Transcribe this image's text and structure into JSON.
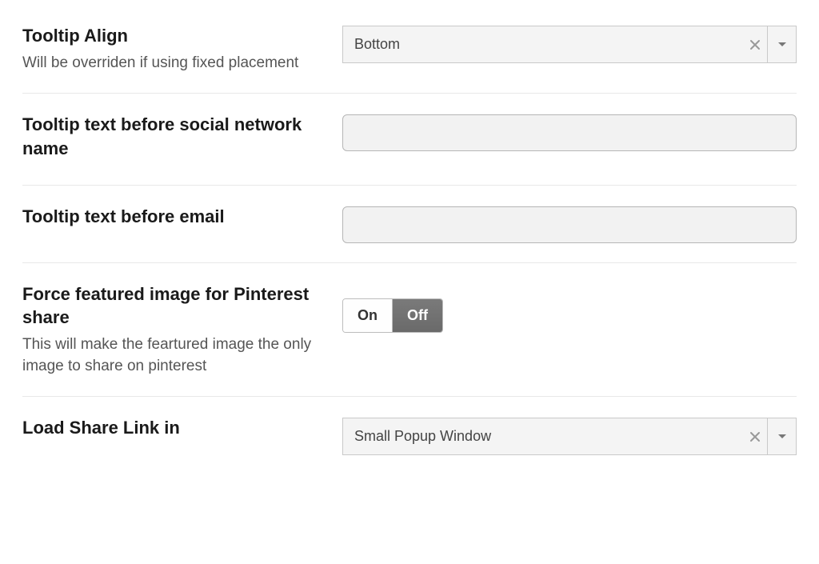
{
  "tooltip_align": {
    "title": "Tooltip Align",
    "desc": "Will be overriden if using fixed placement",
    "value": "Bottom"
  },
  "tooltip_before_social": {
    "title": "Tooltip text before social network name",
    "value": ""
  },
  "tooltip_before_email": {
    "title": "Tooltip text before email",
    "value": ""
  },
  "pinterest_force": {
    "title": "Force featured image for Pinterest share",
    "desc": "This will make the feartured image the only image to share on pinterest",
    "on_label": "On",
    "off_label": "Off",
    "value": "Off"
  },
  "load_share": {
    "title": "Load Share Link in",
    "value": "Small Popup Window"
  }
}
